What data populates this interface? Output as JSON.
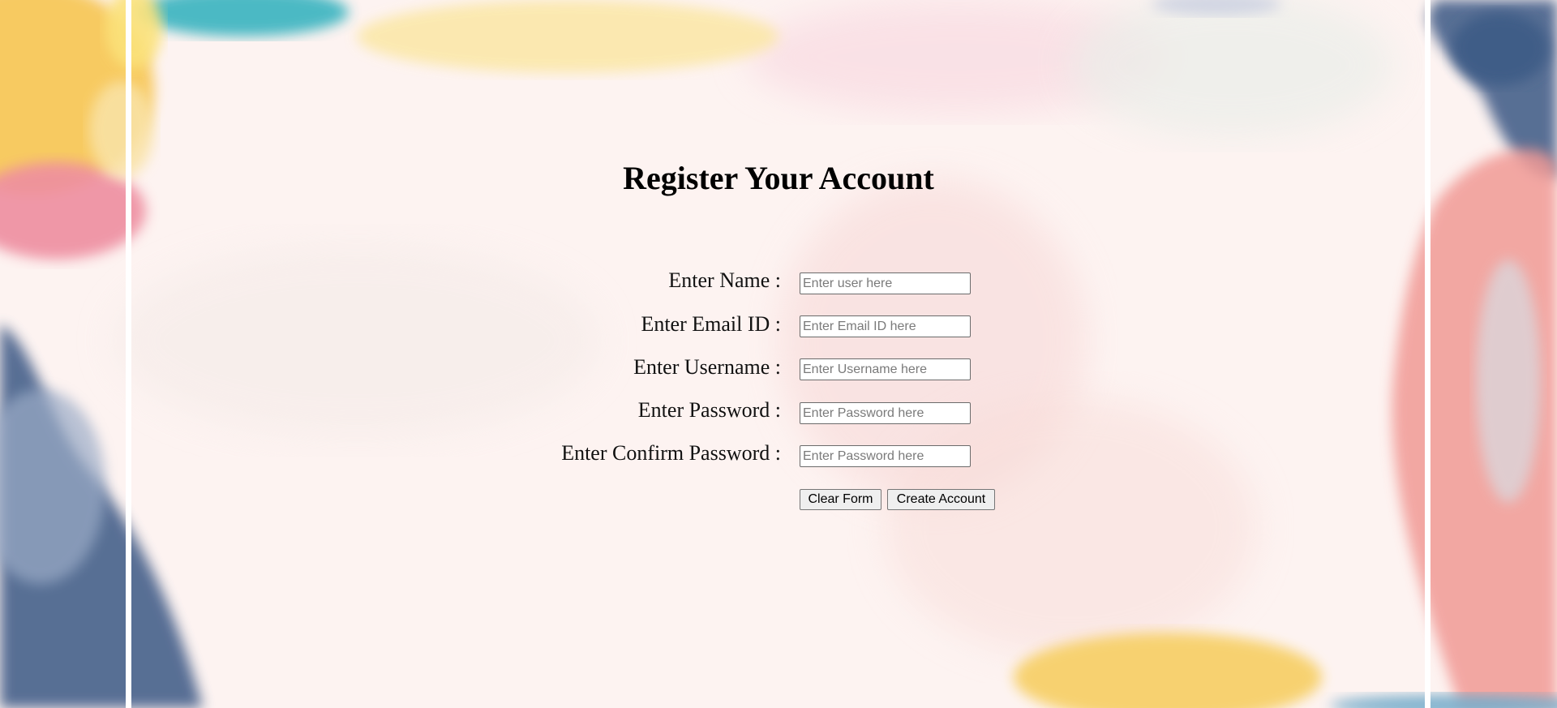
{
  "page": {
    "title": "Register Your Account",
    "background_color": "#fdf3f1"
  },
  "form": {
    "fields": [
      {
        "label": "Enter Name :",
        "placeholder": "Enter user here",
        "value": ""
      },
      {
        "label": "Enter Email ID :",
        "placeholder": "Enter Email ID here",
        "value": ""
      },
      {
        "label": "Enter Username :",
        "placeholder": "Enter Username here",
        "value": ""
      },
      {
        "label": "Enter Password :",
        "placeholder": "Enter Password here",
        "value": ""
      },
      {
        "label": "Enter Confirm Password :",
        "placeholder": "Enter Password here",
        "value": ""
      }
    ],
    "buttons": {
      "clear_label": "Clear Form",
      "create_label": "Create Account"
    }
  },
  "colors": {
    "yellow": "#f7d06a",
    "pink": "#ee8ea0",
    "teal": "#37b3c0",
    "navy": "#4f6790",
    "salmon": "#f19a95"
  }
}
